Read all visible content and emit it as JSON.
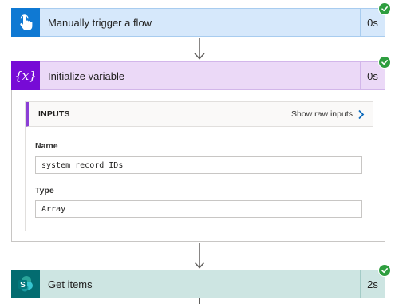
{
  "trigger": {
    "title": "Manually trigger a flow",
    "duration": "0s",
    "icon": "touch-hand-icon",
    "color": "#0f79d3"
  },
  "init_variable": {
    "title": "Initialize variable",
    "duration": "0s",
    "icon": "variable-fx-icon",
    "icon_text": "{x}",
    "color": "#770bd6",
    "inputs": {
      "section_label": "INPUTS",
      "raw_link": "Show raw inputs",
      "fields": [
        {
          "label": "Name",
          "value": "system record IDs"
        },
        {
          "label": "Type",
          "value": "Array"
        }
      ]
    }
  },
  "get_items": {
    "title": "Get items",
    "duration": "2s",
    "icon": "sharepoint-icon",
    "icon_letter": "S",
    "color": "#036c70"
  },
  "status": {
    "success_color": "#2e9e3f"
  }
}
